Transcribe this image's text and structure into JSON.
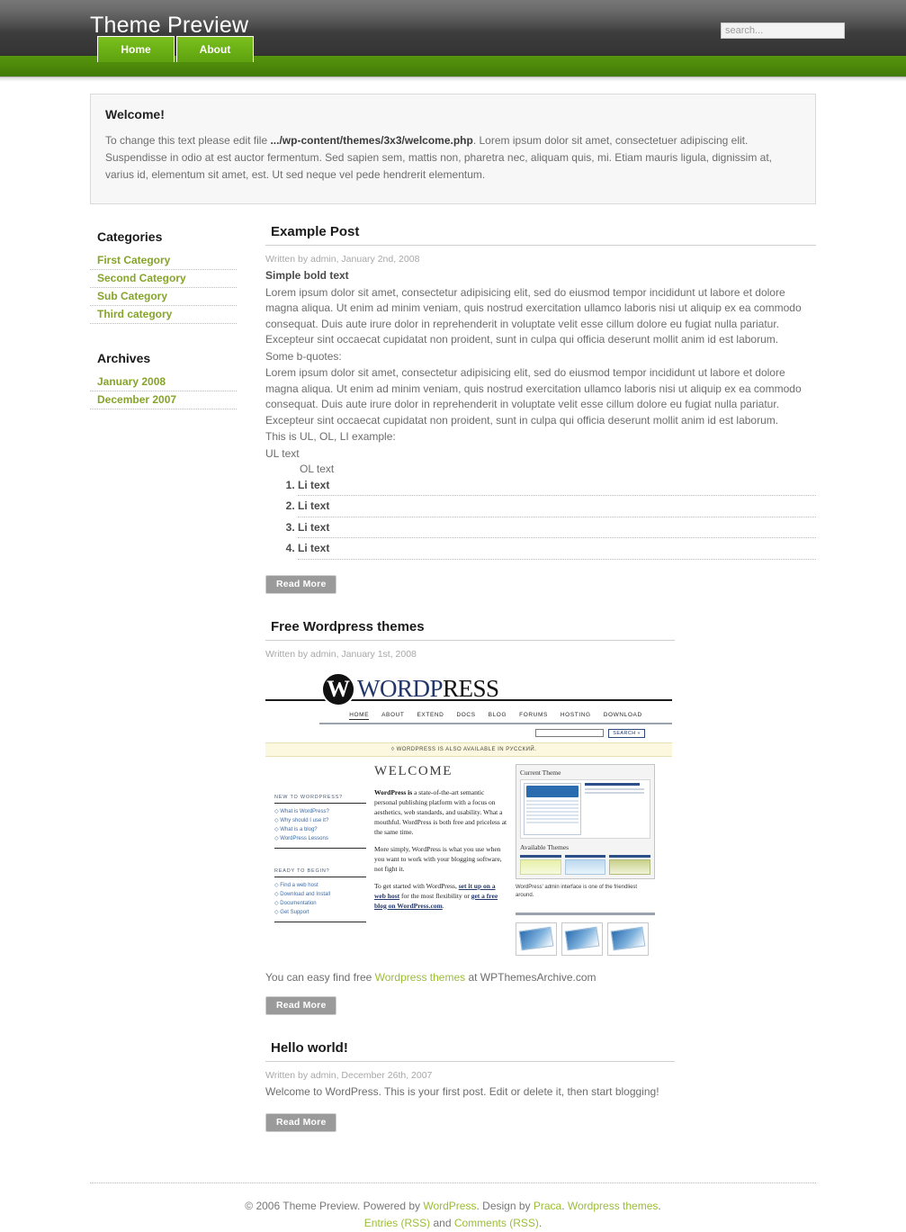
{
  "header": {
    "site_title": "Theme Preview",
    "search_placeholder": "search...",
    "search_value": ""
  },
  "nav": {
    "tabs": [
      {
        "label": "Home"
      },
      {
        "label": "About"
      }
    ]
  },
  "welcome": {
    "title": "Welcome!",
    "text_before": "To change this text please edit file ",
    "file_path": ".../wp-content/themes/3x3/welcome.php",
    "text_after": ". Lorem ipsum dolor sit amet, consectetuer adipiscing elit. Suspendisse in odio at est auctor fermentum. Sed sapien sem, mattis non, pharetra nec, aliquam quis, mi. Etiam mauris ligula, dignissim at, varius id, elementum sit amet, est. Ut sed neque vel pede hendrerit elementum."
  },
  "sidebar": {
    "categories_heading": "Categories",
    "categories": [
      {
        "label": "First Category"
      },
      {
        "label": "Second Category"
      },
      {
        "label": "Sub Category"
      },
      {
        "label": "Third category"
      }
    ],
    "archives_heading": "Archives",
    "archives": [
      {
        "label": "January 2008"
      },
      {
        "label": "December 2007"
      }
    ]
  },
  "posts": {
    "post1": {
      "title": "Example Post",
      "meta": "Written by admin, January 2nd, 2008",
      "bold_text": "Simple bold text",
      "paragraph1": "Lorem ipsum dolor sit amet, consectetur adipisicing elit, sed do eiusmod tempor incididunt ut labore et dolore magna aliqua. Ut enim ad minim veniam, quis nostrud exercitation ullamco laboris nisi ut aliquip ex ea commodo consequat. Duis aute irure dolor in reprehenderit in voluptate velit esse cillum dolore eu fugiat nulla pariatur. Excepteur sint occaecat cupidatat non proident, sunt in culpa qui officia deserunt mollit anim id est laborum.",
      "bquote_label": "Some b-quotes:",
      "paragraph2": "Lorem ipsum dolor sit amet, consectetur adipisicing elit, sed do eiusmod tempor incididunt ut labore et dolore magna aliqua. Ut enim ad minim veniam, quis nostrud exercitation ullamco laboris nisi ut aliquip ex ea commodo consequat. Duis aute irure dolor in reprehenderit in voluptate velit esse cillum dolore eu fugiat nulla pariatur. Excepteur sint occaecat cupidatat non proident, sunt in culpa qui officia deserunt mollit anim id est laborum.",
      "list_intro": "This is UL, OL, LI example:",
      "ul_text": "UL text",
      "ol_text": "OL text",
      "li_items": [
        {
          "label": "Li text"
        },
        {
          "label": "Li text"
        },
        {
          "label": "Li text"
        },
        {
          "label": "Li text"
        }
      ],
      "read_more": "Read More"
    },
    "post2": {
      "title": "Free Wordpress themes",
      "meta": "Written by admin, January 1st, 2008",
      "caption_before": "You can easy find free ",
      "caption_link": "Wordpress themes",
      "caption_after": " at WPThemesArchive.com",
      "read_more": "Read More"
    },
    "post3": {
      "title": "Hello world!",
      "meta": "Written by admin, December 26th, 2007",
      "body": "Welcome to WordPress. This is your first post. Edit or delete it, then start blogging!",
      "read_more": "Read More"
    }
  },
  "wp_screenshot": {
    "logo_mark": "W",
    "wordmark_a": "W",
    "wordmark_b": "ORD",
    "wordmark_c": "P",
    "wordmark_d": "RESS",
    "nav": [
      {
        "label": "HOME"
      },
      {
        "label": "ABOUT"
      },
      {
        "label": "EXTEND"
      },
      {
        "label": "DOCS"
      },
      {
        "label": "BLOG"
      },
      {
        "label": "FORUMS"
      },
      {
        "label": "HOSTING"
      },
      {
        "label": "DOWNLOAD"
      }
    ],
    "search_button": "SEARCH »",
    "banner": "◊ WORDPRESS IS ALSO AVAILABLE IN РУССКИЙ.",
    "welcome_heading": "WELCOME",
    "kicker_new": "NEW TO WORDPRESS?",
    "links_new": [
      {
        "label": "What is WordPress?"
      },
      {
        "label": "Why should I use it?"
      },
      {
        "label": "What is a blog?"
      },
      {
        "label": "WordPress Lessons"
      }
    ],
    "kicker_ready": "READY TO BEGIN?",
    "links_ready": [
      {
        "label": "Find a web host"
      },
      {
        "label": "Download and Install"
      },
      {
        "label": "Documentation"
      },
      {
        "label": "Get Support"
      }
    ],
    "para1_bold": "WordPress is",
    "para1": " a state-of-the-art semantic personal publishing platform with a focus on aesthetics, web standards, and usability. What a mouthful. WordPress is both free and priceless at the same time.",
    "para2": "More simply, WordPress is what you use when you want to work with your blogging software, not fight it.",
    "para3_before": "To get started with WordPress, ",
    "para3_link1": "set it up on a web host",
    "para3_mid": " for the most flexibility or ",
    "para3_link2": "get a free blog on WordPress.com",
    "para3_after": ".",
    "panel_current": "Current Theme",
    "panel_available": "Available Themes",
    "panel_caption": "WordPress' admin interface is one of the friendliest around."
  },
  "footer": {
    "copyright": "© 2006 Theme Preview. Powered by ",
    "link_wordpress": "WordPress",
    "mid1": ". Design by ",
    "link_praca": "Praca",
    "mid2": ". ",
    "link_themes": "Wordpress themes",
    "mid3": ".",
    "link_entries": "Entries (RSS)",
    "and_text": " and ",
    "link_comments": "Comments (RSS)",
    "end_text": "."
  },
  "colors": {
    "accent_green": "#86a42a",
    "link_green": "#9bbd36",
    "navbar_green": "#4e8a0b",
    "tab_green": "#6db316",
    "header_dark": "#3c3c3c",
    "button_gray": "#9a9a9a"
  }
}
